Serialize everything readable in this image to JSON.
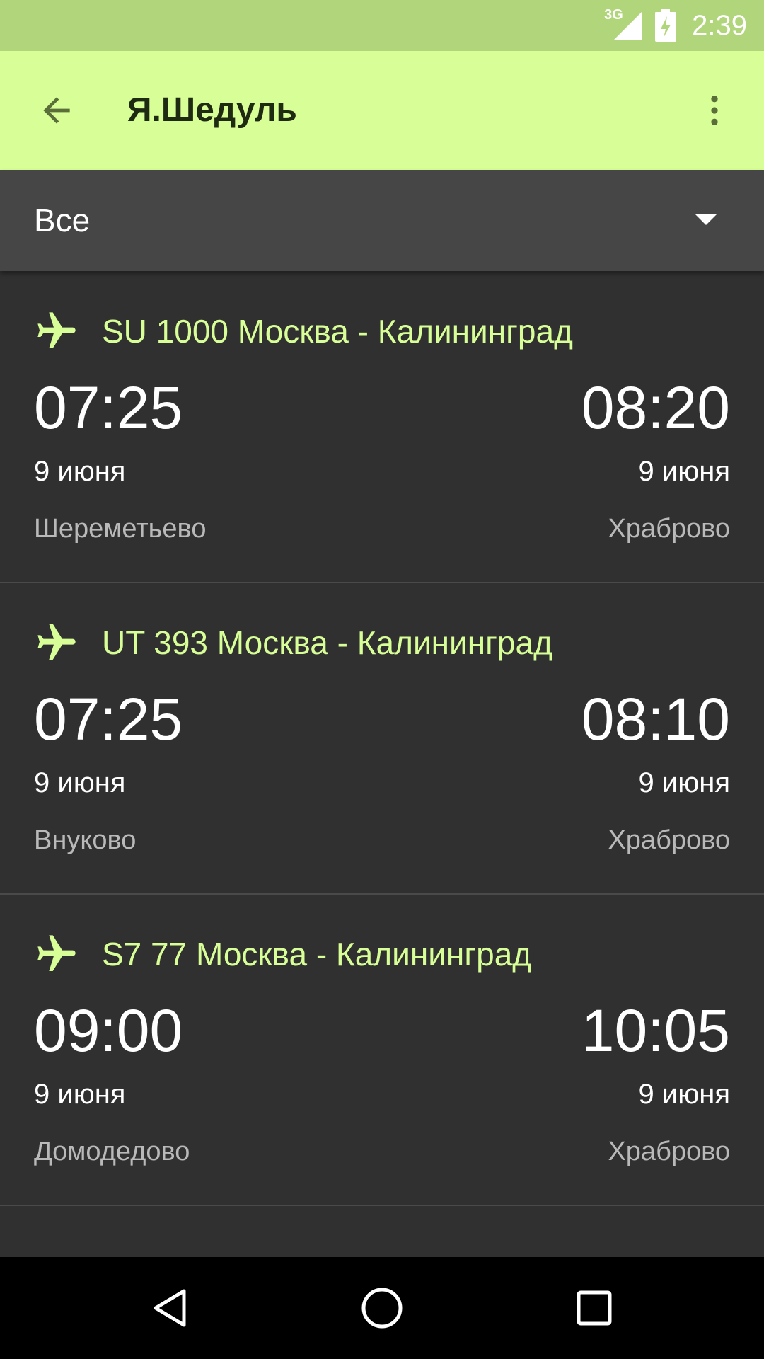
{
  "status_bar": {
    "network": "3G",
    "time": "2:39",
    "icons": [
      "signal-icon",
      "battery-charging-icon"
    ]
  },
  "app_bar": {
    "title": "Я.Шедуль",
    "icons": [
      "back-arrow-icon",
      "more-vert-icon"
    ]
  },
  "filter": {
    "selected": "Все",
    "icon": "dropdown-arrow-icon"
  },
  "colors": {
    "accent": "#d8ff97",
    "status_bar": "#b0d57a",
    "background": "#303030",
    "filter_bar": "#464646"
  },
  "flights": [
    {
      "title": "SU 1000 Москва - Калининград",
      "dep_time": "07:25",
      "dep_date": "9 июня",
      "dep_airport": "Шереметьево",
      "arr_time": "08:20",
      "arr_date": "9 июня",
      "arr_airport": "Храброво"
    },
    {
      "title": "UT 393 Москва - Калининград",
      "dep_time": "07:25",
      "dep_date": "9 июня",
      "dep_airport": "Внуково",
      "arr_time": "08:10",
      "arr_date": "9 июня",
      "arr_airport": "Храброво"
    },
    {
      "title": "S7 77 Москва - Калининград",
      "dep_time": "09:00",
      "dep_date": "9 июня",
      "dep_airport": "Домодедово",
      "arr_time": "10:05",
      "arr_date": "9 июня",
      "arr_airport": "Храброво"
    }
  ],
  "nav_bar": {
    "icons": [
      "nav-back-icon",
      "nav-home-icon",
      "nav-recents-icon"
    ]
  }
}
